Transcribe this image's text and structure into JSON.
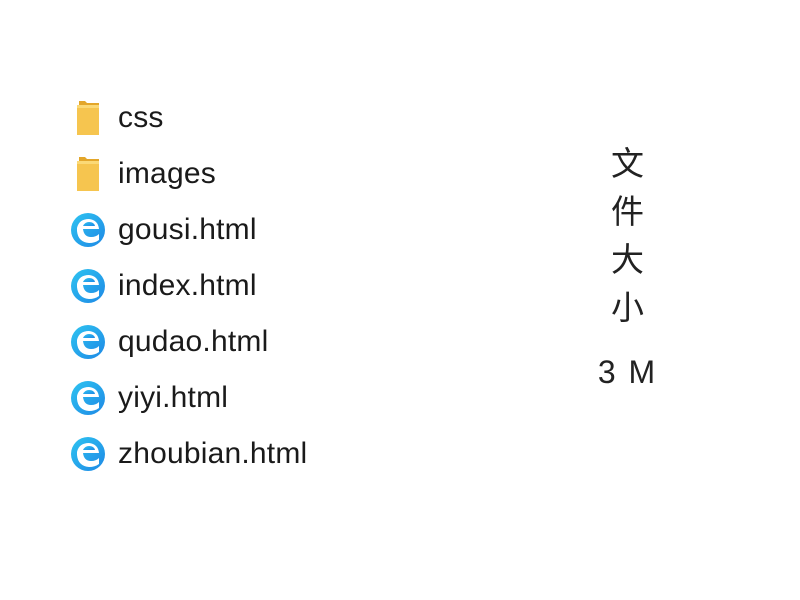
{
  "files": [
    {
      "name": "css",
      "type": "folder",
      "icon": "folder-icon"
    },
    {
      "name": "images",
      "type": "folder",
      "icon": "folder-icon"
    },
    {
      "name": "gousi.html",
      "type": "html",
      "icon": "edge-html-file-icon"
    },
    {
      "name": "index.html",
      "type": "html",
      "icon": "edge-html-file-icon"
    },
    {
      "name": "qudao.html",
      "type": "html",
      "icon": "edge-html-file-icon"
    },
    {
      "name": "yiyi.html",
      "type": "html",
      "icon": "edge-html-file-icon"
    },
    {
      "name": "zhoubian.html",
      "type": "html",
      "icon": "edge-html-file-icon"
    }
  ],
  "side": {
    "label": "文件大小",
    "size": "3 M"
  },
  "colors": {
    "folder": "#f6c54f",
    "folder_dark": "#e3a62a",
    "edge_blue": "#1e88e5",
    "edge_cyan": "#2ec4f1"
  }
}
